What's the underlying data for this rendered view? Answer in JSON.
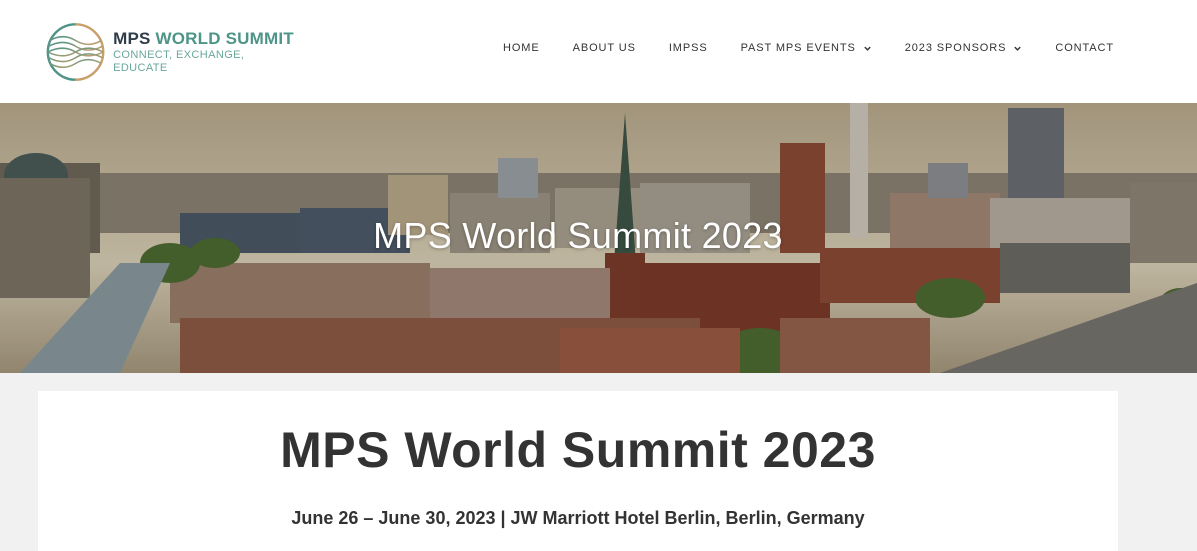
{
  "logo": {
    "title_part1": "MPS",
    "title_part2": "WORLD SUMMIT",
    "tagline": "CONNECT, EXCHANGE, EDUCATE"
  },
  "nav": {
    "items": [
      {
        "label": "HOME"
      },
      {
        "label": "ABOUT US"
      },
      {
        "label": "IMPSS"
      },
      {
        "label": "PAST MPS EVENTS"
      },
      {
        "label": "2023 SPONSORS"
      },
      {
        "label": "CONTACT"
      }
    ]
  },
  "hero": {
    "title": "MPS World Summit 2023"
  },
  "main": {
    "title": "MPS World Summit 2023",
    "subtitle": "June 26 – June 30, 2023 | JW Marriott Hotel Berlin, Berlin, Germany"
  },
  "colors": {
    "brand_dark": "#2f3d4a",
    "brand_teal": "#4f9488",
    "brand_gold": "#c8a06a"
  }
}
